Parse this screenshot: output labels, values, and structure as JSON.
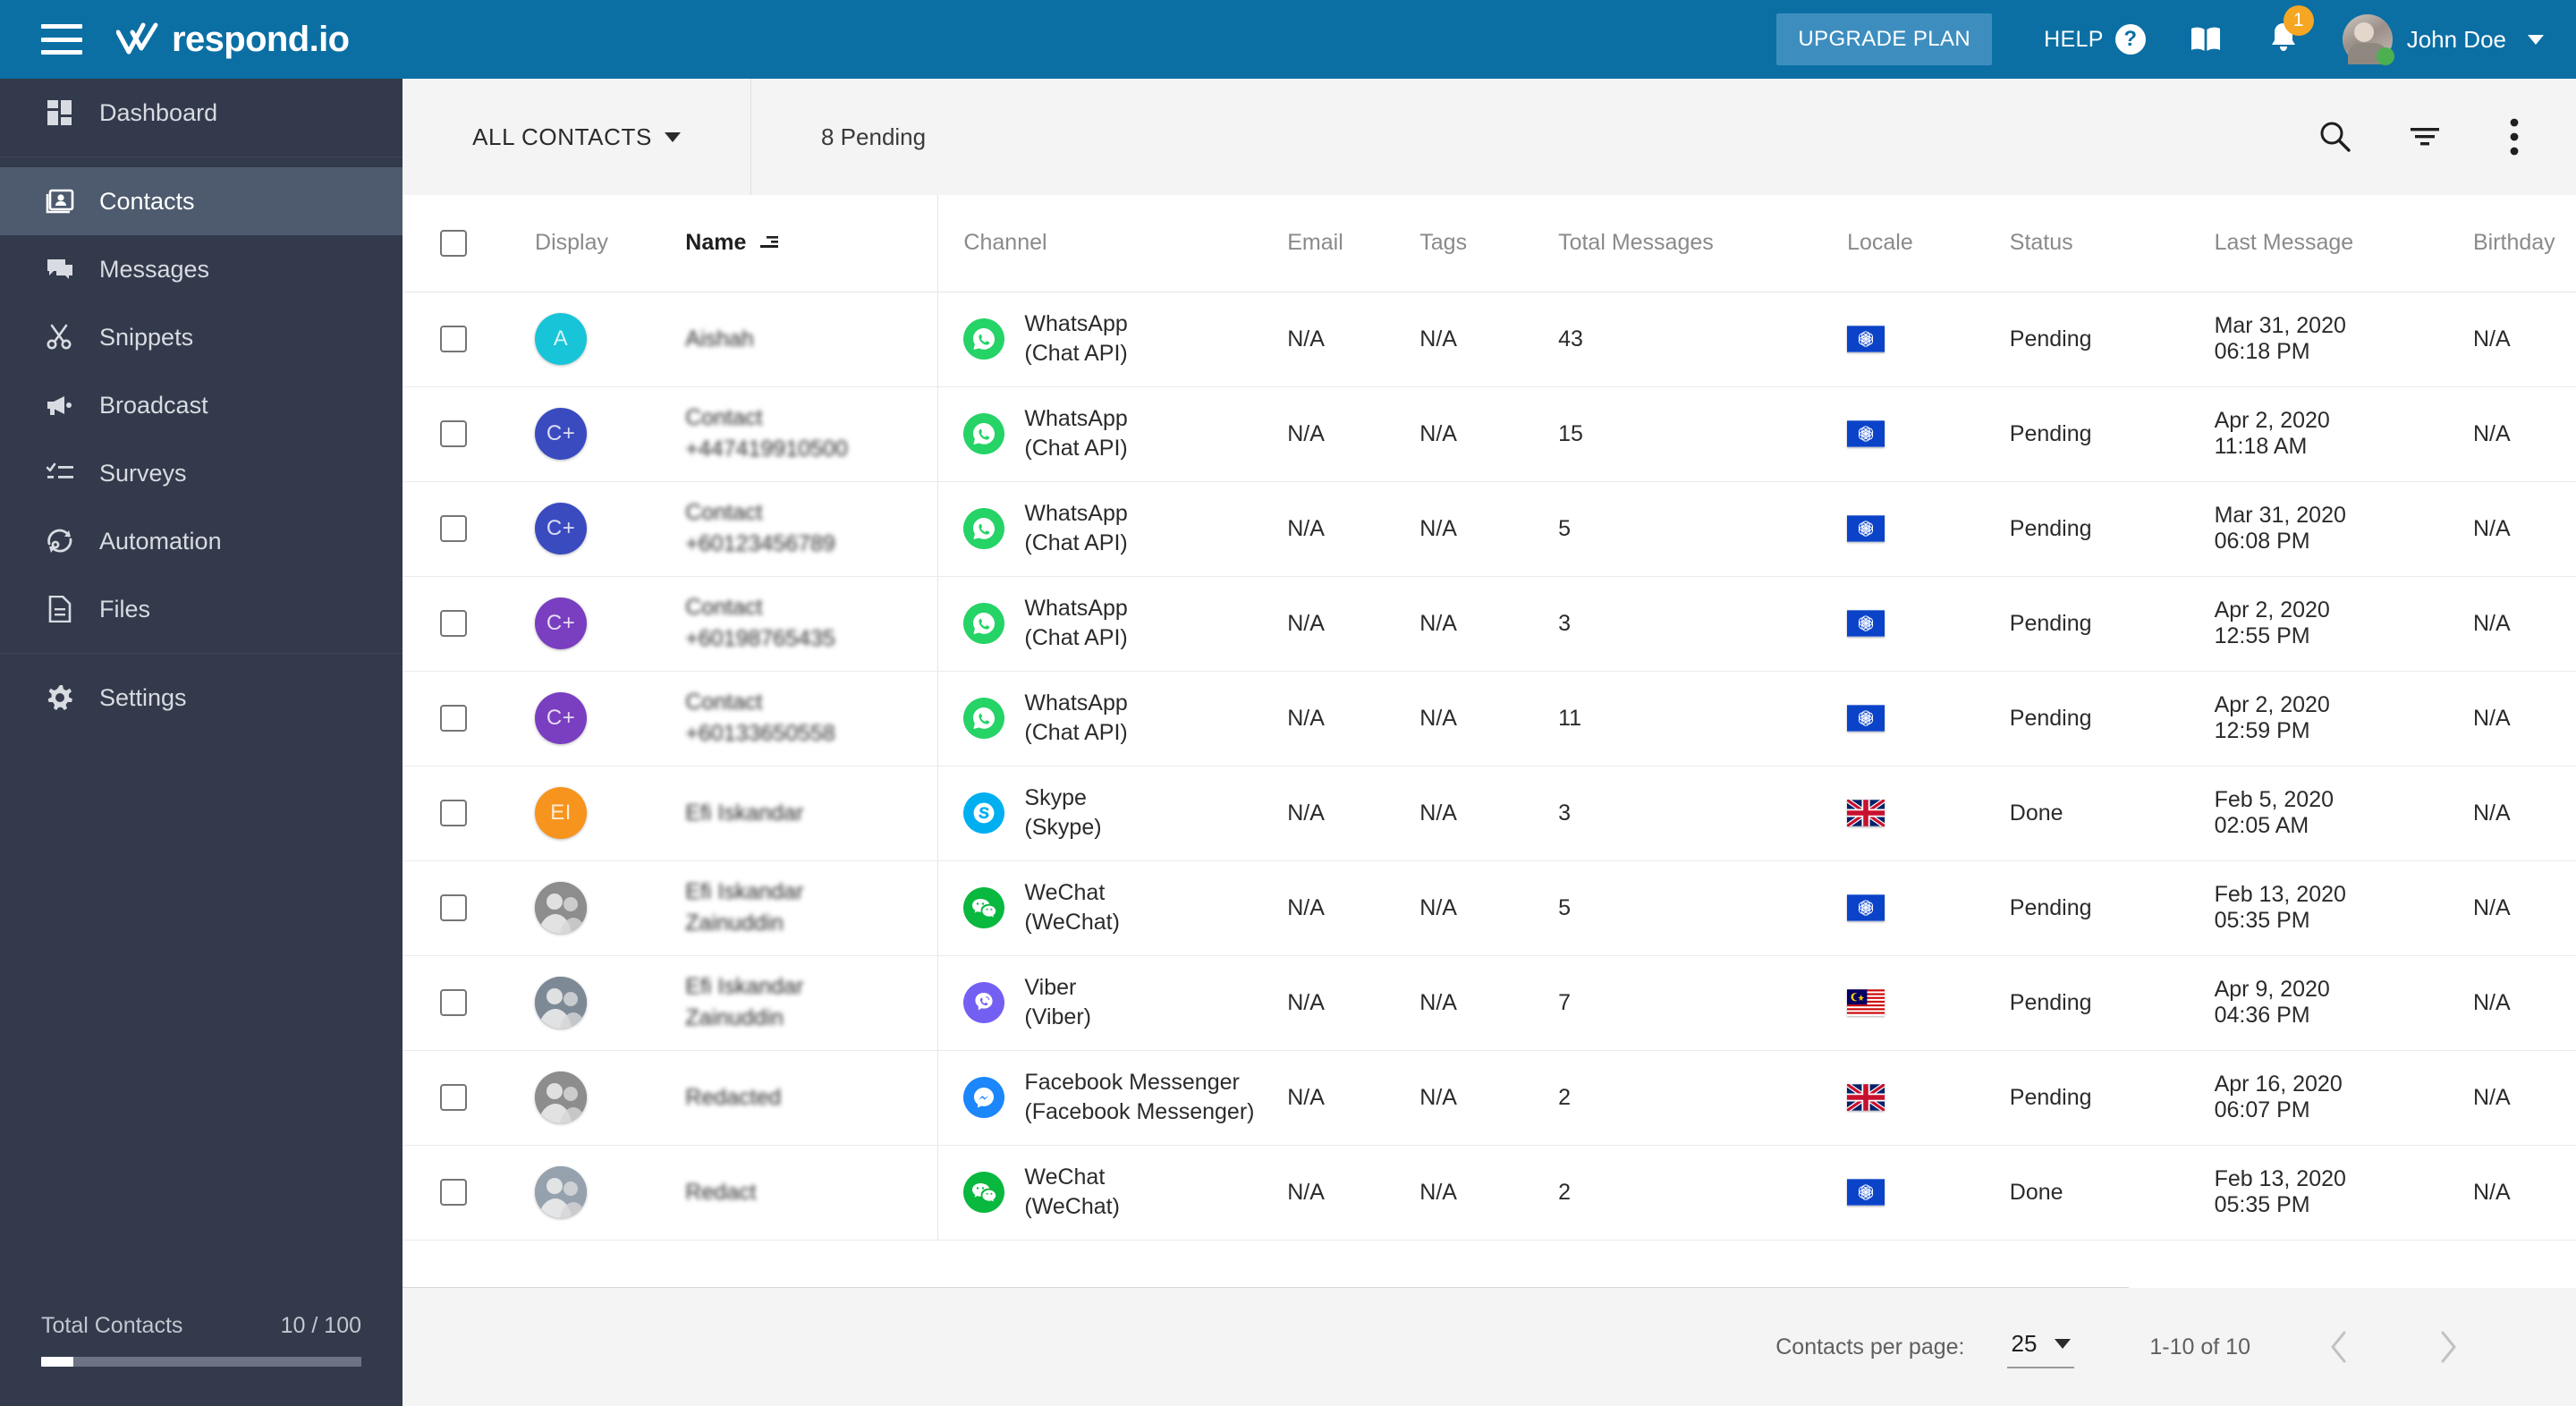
{
  "topbar": {
    "menu_icon": "hamburger-menu-icon",
    "logo_text": "respond.io",
    "logo_icon": "double-check-logo-icon",
    "upgrade_label": "UPGRADE PLAN",
    "help_label": "HELP",
    "help_icon": "question-mark-icon",
    "book_icon": "book-icon",
    "bell_icon": "notification-bell-icon",
    "notification_count": "1",
    "user_name": "John Doe",
    "avatar_icon": "user-avatar",
    "caret_icon": "chevron-down-icon",
    "brand_color": "#0b6fa4",
    "badge_color": "#f5a623"
  },
  "sidebar": {
    "items": [
      {
        "label": "Dashboard",
        "icon": "dashboard-grid-icon",
        "active": false
      },
      {
        "label": "Contacts",
        "icon": "contacts-card-icon",
        "active": true
      },
      {
        "label": "Messages",
        "icon": "chat-bubbles-icon",
        "active": false
      },
      {
        "label": "Snippets",
        "icon": "scissors-icon",
        "active": false
      },
      {
        "label": "Broadcast",
        "icon": "megaphone-icon",
        "active": false
      },
      {
        "label": "Surveys",
        "icon": "checklist-icon",
        "active": false
      },
      {
        "label": "Automation",
        "icon": "refresh-gear-icon",
        "active": false
      },
      {
        "label": "Files",
        "icon": "document-icon",
        "active": false
      },
      {
        "label": "Settings",
        "icon": "gear-icon",
        "active": false
      }
    ],
    "total_contacts_label": "Total Contacts",
    "total_contacts_value": "10 / 100",
    "total_contacts_percent": 10,
    "background_color": "#323a4b",
    "active_color": "#4e5a6e"
  },
  "toolbar": {
    "filter_label": "ALL CONTACTS",
    "filter_caret": "chevron-down-icon",
    "pending_label": "8 Pending",
    "search_icon": "search-icon",
    "filter_icon": "filter-funnel-icon",
    "more_icon": "more-vertical-icon"
  },
  "table": {
    "select_all_checkbox": "select-all-checkbox",
    "sort_icon": "sort-descending-icon",
    "sorted_column": "Name",
    "columns": [
      "Display",
      "Name",
      "Channel",
      "Email",
      "Tags",
      "Total Messages",
      "Locale",
      "Status",
      "Last Message",
      "Birthday"
    ],
    "rows": [
      {
        "avatar_type": "initials",
        "initials": "A",
        "avatar_color": "#18c4d8",
        "name_line1": "Aishah",
        "name_line2": "",
        "channel": "WhatsApp",
        "channel_sub": "(Chat API)",
        "channel_icon": "whatsapp-icon",
        "email": "N/A",
        "tags": "N/A",
        "total_messages": "43",
        "locale": "international-flag",
        "status": "Pending",
        "last_message_date": "Mar 31, 2020",
        "last_message_time": "06:18 PM",
        "birthday": "N/A"
      },
      {
        "avatar_type": "initials",
        "initials": "C+",
        "avatar_color": "#3a4bc0",
        "name_line1": "Contact",
        "name_line2": "+447419910500",
        "channel": "WhatsApp",
        "channel_sub": "(Chat API)",
        "channel_icon": "whatsapp-icon",
        "email": "N/A",
        "tags": "N/A",
        "total_messages": "15",
        "locale": "international-flag",
        "status": "Pending",
        "last_message_date": "Apr 2, 2020",
        "last_message_time": "11:18 AM",
        "birthday": "N/A"
      },
      {
        "avatar_type": "initials",
        "initials": "C+",
        "avatar_color": "#3a4bc0",
        "name_line1": "Contact",
        "name_line2": "+60123456789",
        "channel": "WhatsApp",
        "channel_sub": "(Chat API)",
        "channel_icon": "whatsapp-icon",
        "email": "N/A",
        "tags": "N/A",
        "total_messages": "5",
        "locale": "international-flag",
        "status": "Pending",
        "last_message_date": "Mar 31, 2020",
        "last_message_time": "06:08 PM",
        "birthday": "N/A"
      },
      {
        "avatar_type": "initials",
        "initials": "C+",
        "avatar_color": "#7a3ec0",
        "name_line1": "Contact",
        "name_line2": "+60198765435",
        "channel": "WhatsApp",
        "channel_sub": "(Chat API)",
        "channel_icon": "whatsapp-icon",
        "email": "N/A",
        "tags": "N/A",
        "total_messages": "3",
        "locale": "international-flag",
        "status": "Pending",
        "last_message_date": "Apr 2, 2020",
        "last_message_time": "12:55 PM",
        "birthday": "N/A"
      },
      {
        "avatar_type": "initials",
        "initials": "C+",
        "avatar_color": "#7a3ec0",
        "name_line1": "Contact",
        "name_line2": "+60133650558",
        "channel": "WhatsApp",
        "channel_sub": "(Chat API)",
        "channel_icon": "whatsapp-icon",
        "email": "N/A",
        "tags": "N/A",
        "total_messages": "11",
        "locale": "international-flag",
        "status": "Pending",
        "last_message_date": "Apr 2, 2020",
        "last_message_time": "12:59 PM",
        "birthday": "N/A"
      },
      {
        "avatar_type": "initials",
        "initials": "EI",
        "avatar_color": "#f7941d",
        "name_line1": "Efi Iskandar",
        "name_line2": "",
        "channel": "Skype",
        "channel_sub": "(Skype)",
        "channel_icon": "skype-icon",
        "email": "N/A",
        "tags": "N/A",
        "total_messages": "3",
        "locale": "uk-flag",
        "status": "Done",
        "last_message_date": "Feb 5, 2020",
        "last_message_time": "02:05 AM",
        "birthday": "N/A"
      },
      {
        "avatar_type": "photo",
        "initials": "",
        "avatar_color": "#8d8d8d",
        "name_line1": "Efi Iskandar",
        "name_line2": "Zainuddin",
        "channel": "WeChat",
        "channel_sub": "(WeChat)",
        "channel_icon": "wechat-icon",
        "email": "N/A",
        "tags": "N/A",
        "total_messages": "5",
        "locale": "international-flag",
        "status": "Pending",
        "last_message_date": "Feb 13, 2020",
        "last_message_time": "05:35 PM",
        "birthday": "N/A"
      },
      {
        "avatar_type": "photo",
        "initials": "",
        "avatar_color": "#7d8a96",
        "name_line1": "Efi Iskandar",
        "name_line2": "Zainuddin",
        "channel": "Viber",
        "channel_sub": "(Viber)",
        "channel_icon": "viber-icon",
        "email": "N/A",
        "tags": "N/A",
        "total_messages": "7",
        "locale": "malaysia-flag",
        "status": "Pending",
        "last_message_date": "Apr 9, 2020",
        "last_message_time": "04:36 PM",
        "birthday": "N/A"
      },
      {
        "avatar_type": "photo",
        "initials": "",
        "avatar_color": "#8d8d8d",
        "name_line1": "Redacted",
        "name_line2": "",
        "channel": "Facebook Messenger",
        "channel_sub": "(Facebook Messenger)",
        "channel_icon": "facebook-messenger-icon",
        "email": "N/A",
        "tags": "N/A",
        "total_messages": "2",
        "locale": "uk-flag",
        "status": "Pending",
        "last_message_date": "Apr 16, 2020",
        "last_message_time": "06:07 PM",
        "birthday": "N/A"
      },
      {
        "avatar_type": "photo",
        "initials": "",
        "avatar_color": "#95a2ad",
        "name_line1": "Redact",
        "name_line2": "",
        "channel": "WeChat",
        "channel_sub": "(WeChat)",
        "channel_icon": "wechat-icon",
        "email": "N/A",
        "tags": "N/A",
        "total_messages": "2",
        "locale": "international-flag",
        "status": "Done",
        "last_message_date": "Feb 13, 2020",
        "last_message_time": "05:35 PM",
        "birthday": "N/A"
      }
    ]
  },
  "footer": {
    "per_page_label": "Contacts per page:",
    "per_page_value": "25",
    "per_page_caret": "chevron-down-icon",
    "range_label": "1-10 of 10",
    "prev_icon": "chevron-left-icon",
    "next_icon": "chevron-right-icon"
  }
}
